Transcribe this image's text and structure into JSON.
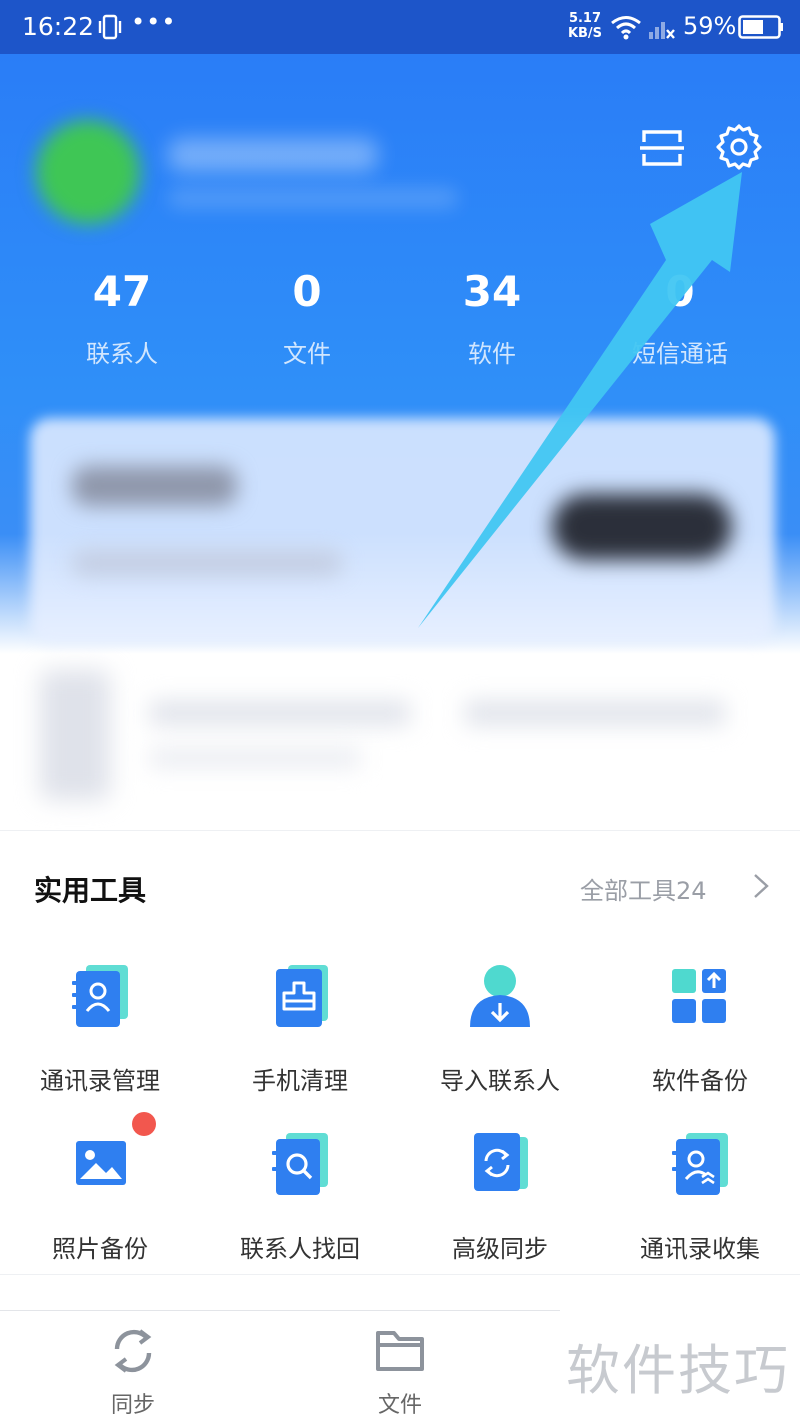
{
  "status_bar": {
    "time": "16:22",
    "more": "•••",
    "speed_value": "5.17",
    "speed_unit": "KB/S",
    "battery": "59%"
  },
  "header": {
    "stats": [
      {
        "value": "47",
        "label": "联系人"
      },
      {
        "value": "0",
        "label": "文件"
      },
      {
        "value": "34",
        "label": "软件"
      },
      {
        "value": "0",
        "label": "短信通话"
      }
    ]
  },
  "tools": {
    "title": "实用工具",
    "all_link": "全部工具24",
    "items": [
      {
        "label": "通讯录管理",
        "icon": "contacts-book-icon"
      },
      {
        "label": "手机清理",
        "icon": "phone-clean-icon"
      },
      {
        "label": "导入联系人",
        "icon": "import-contact-icon"
      },
      {
        "label": "软件备份",
        "icon": "app-backup-icon"
      },
      {
        "label": "照片备份",
        "icon": "photo-backup-icon"
      },
      {
        "label": "联系人找回",
        "icon": "contact-recover-icon"
      },
      {
        "label": "高级同步",
        "icon": "advanced-sync-icon"
      },
      {
        "label": "通讯录收集",
        "icon": "contacts-collect-icon"
      }
    ]
  },
  "bottom_nav": {
    "items": [
      {
        "label": "同步",
        "icon": "sync-icon"
      },
      {
        "label": "文件",
        "icon": "folder-icon"
      }
    ]
  },
  "watermark": "软件技巧",
  "colors": {
    "header_blue": "#2a7df7",
    "tool_blue": "#2f7ff0",
    "tool_teal": "#4fd9cf",
    "badge_red": "#f2574e",
    "annotation_arrow": "#41c6f2"
  }
}
